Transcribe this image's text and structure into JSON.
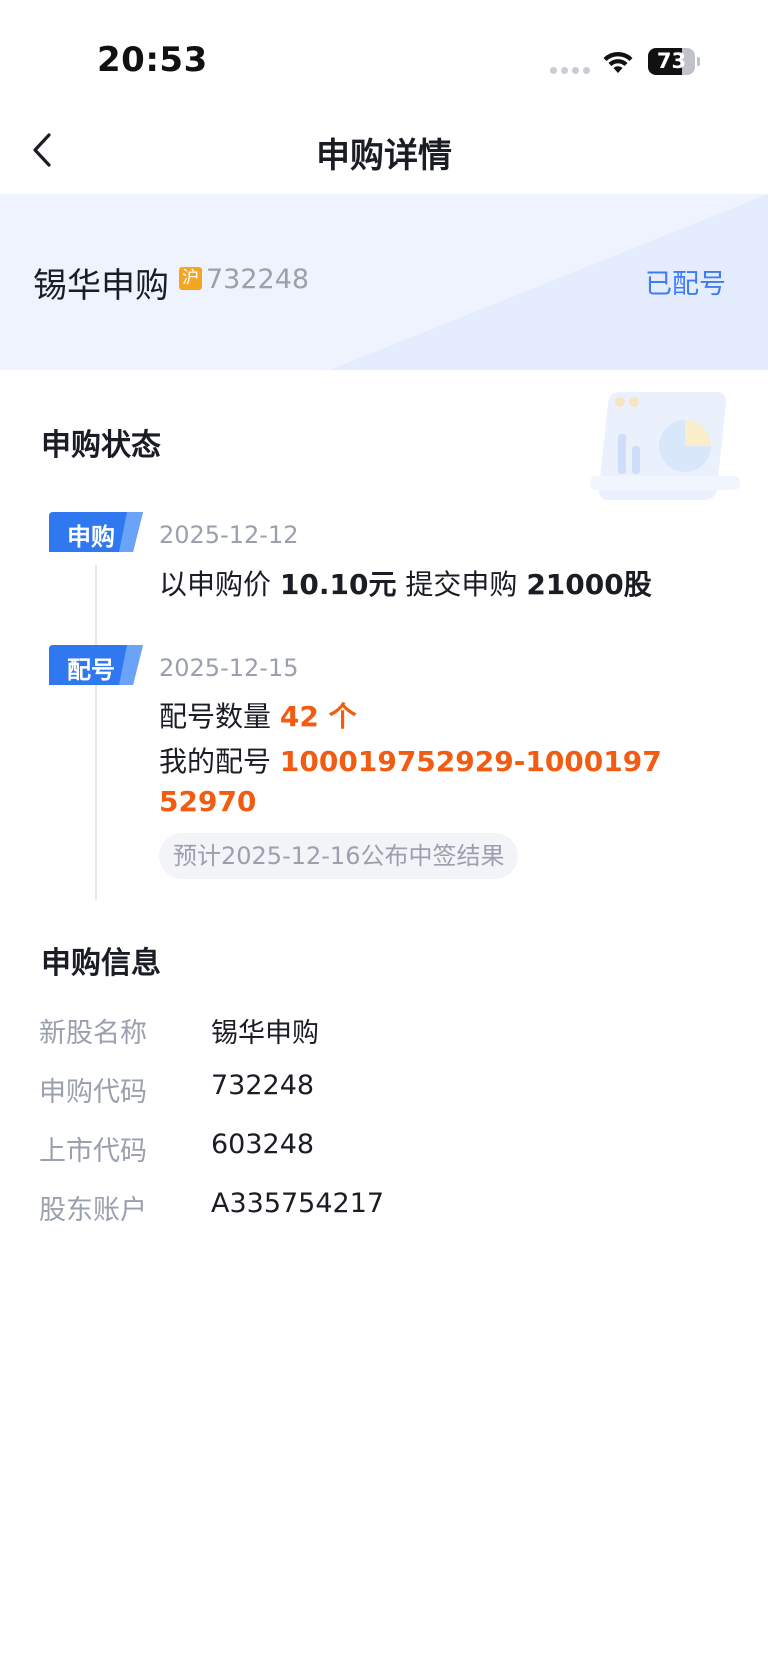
{
  "status_bar": {
    "time": "20:53",
    "battery": "73"
  },
  "nav": {
    "title": "申购详情"
  },
  "header": {
    "stock_name": "锡华申购",
    "market_badge": "沪",
    "code": "732248",
    "status": "已配号"
  },
  "status_section": {
    "title": "申购状态",
    "steps": [
      {
        "badge": "申购",
        "date": "2025-12-12",
        "text_prefix": "以申购价",
        "price": "10.10元",
        "text_mid": "提交申购",
        "shares": "21000股"
      },
      {
        "badge": "配号",
        "date": "2025-12-15",
        "count_label": "配号数量",
        "count_value": "42 个",
        "range_label": "我的配号",
        "range_value": "100019752929-100019752970",
        "result_note": "预计2025-12-16公布中签结果"
      }
    ]
  },
  "info_section": {
    "title": "申购信息",
    "rows": [
      {
        "label": "新股名称",
        "value": "锡华申购"
      },
      {
        "label": "申购代码",
        "value": "732248"
      },
      {
        "label": "上市代码",
        "value": "603248"
      },
      {
        "label": "股东账户",
        "value": "A335754217"
      }
    ]
  },
  "colors": {
    "accent": "#3d7cf3",
    "highlight": "#f25c12",
    "badge_gold": "#f4a521"
  }
}
